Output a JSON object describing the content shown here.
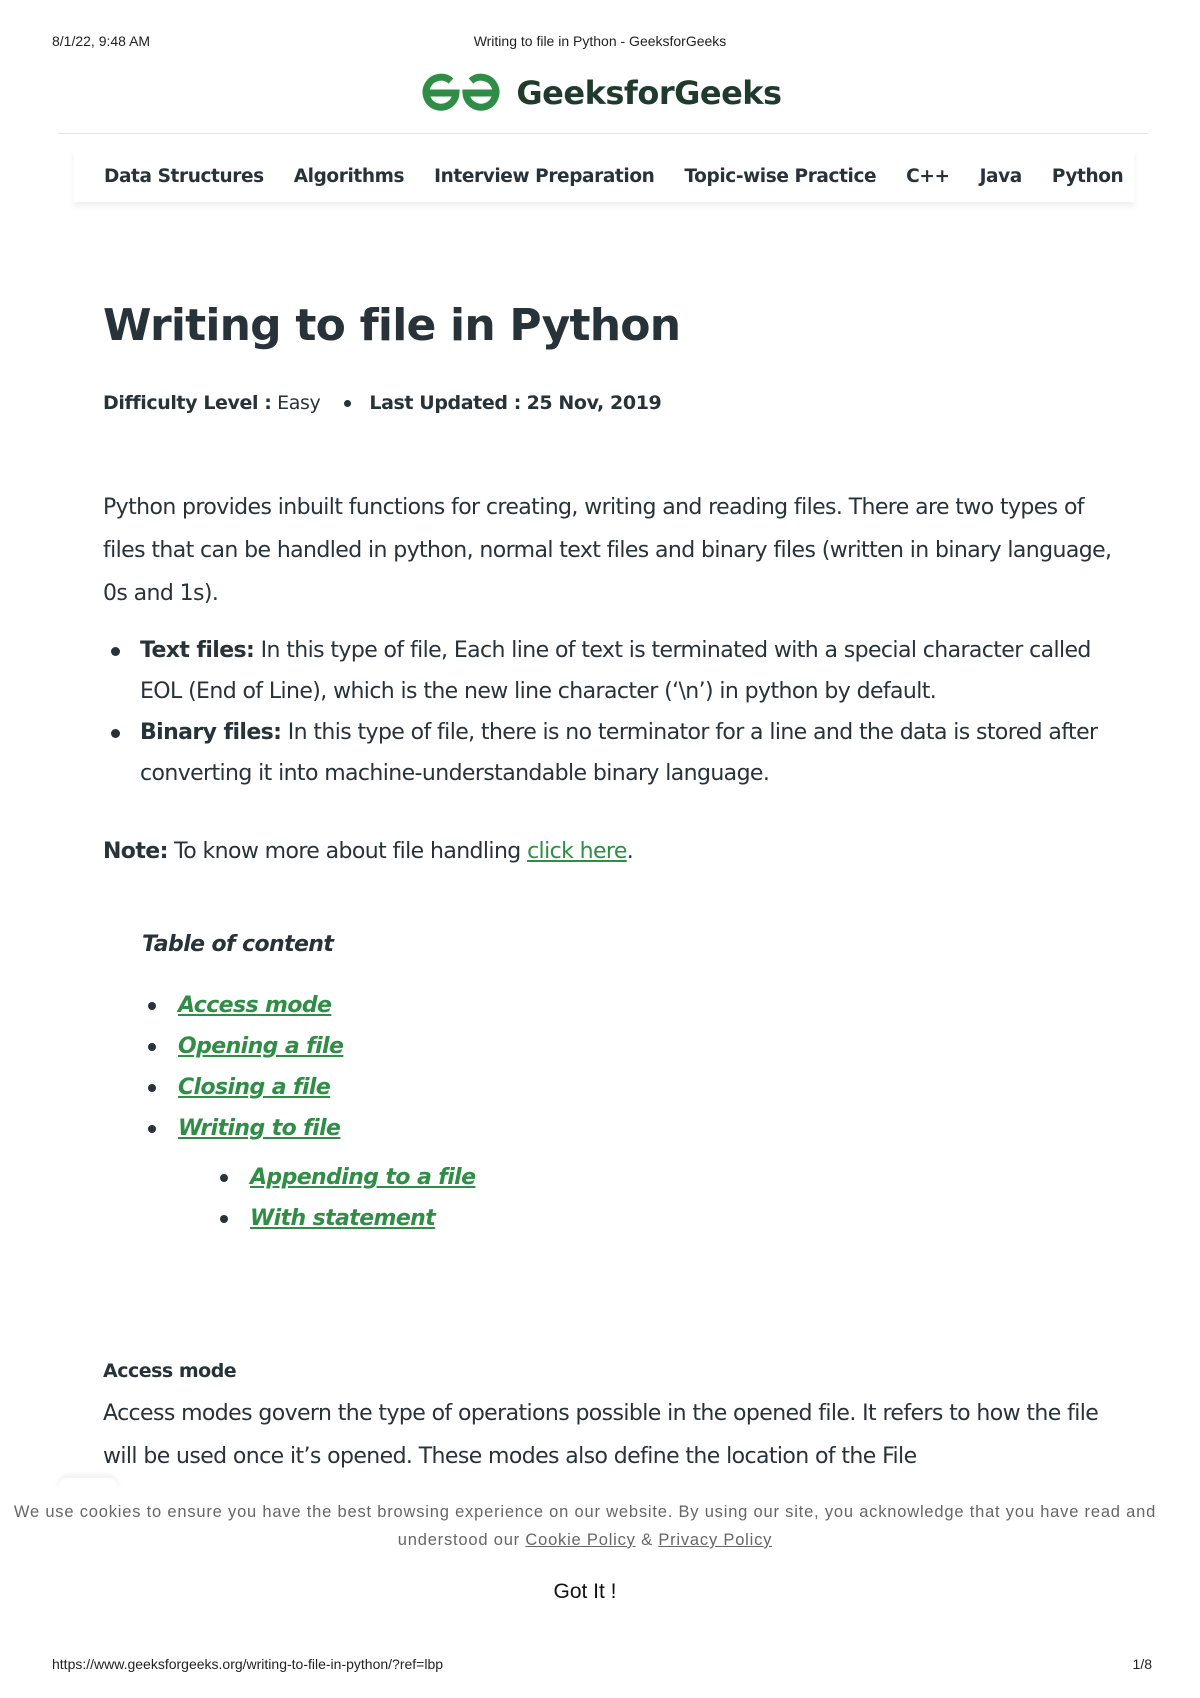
{
  "print_header": {
    "datetime": "8/1/22, 9:48 AM",
    "page_title": "Writing to file in Python - GeeksforGeeks"
  },
  "brand": {
    "name": "GeeksforGeeks",
    "logo_icon": "gfg-logo-icon",
    "color": "#2f8d46"
  },
  "nav": {
    "items": [
      "Data Structures",
      "Algorithms",
      "Interview Preparation",
      "Topic-wise Practice",
      "C++",
      "Java",
      "Python"
    ]
  },
  "article": {
    "title": "Writing to file in Python",
    "difficulty_label": "Difficulty Level :",
    "difficulty_value": "Easy",
    "updated_label": "Last Updated :",
    "updated_value": "25 Nov, 2019",
    "intro": "Python provides inbuilt functions for creating, writing and reading files. There are two types of files that can be handled in python, normal text files and binary files (written in binary language, 0s and 1s).",
    "bullets": [
      {
        "term": "Text files:",
        "text": " In this type of file, Each line of text is terminated with a special character called EOL (End of Line), which is the new line character (‘\\n’) in python by default."
      },
      {
        "term": "Binary files:",
        "text": " In this type of file, there is no terminator for a line and the data is stored after converting it into machine-understandable binary language."
      }
    ],
    "note_label": "Note:",
    "note_text": " To know more about file handling ",
    "note_link": "click here",
    "note_end": "."
  },
  "toc": {
    "title": "Table of content",
    "items": [
      "Access mode",
      "Opening a file",
      "Closing a file",
      "Writing to file"
    ],
    "subitems": [
      "Appending to a file",
      "With statement"
    ]
  },
  "section": {
    "heading": "Access mode",
    "text": "Access modes govern the type of operations possible in the opened file. It refers to how the file will be used once it’s opened. These modes also define the location of the File"
  },
  "cookie": {
    "text": "We use cookies to ensure you have the best browsing experience on our website. By using our site, you acknowledge that you have read and understood our ",
    "cookie_policy": "Cookie Policy",
    "amp": " & ",
    "privacy_policy": "Privacy Policy",
    "button": "Got It !"
  },
  "print_footer": {
    "url": "https://www.geeksforgeeks.org/writing-to-file-in-python/?ref=lbp",
    "page": "1/8"
  }
}
